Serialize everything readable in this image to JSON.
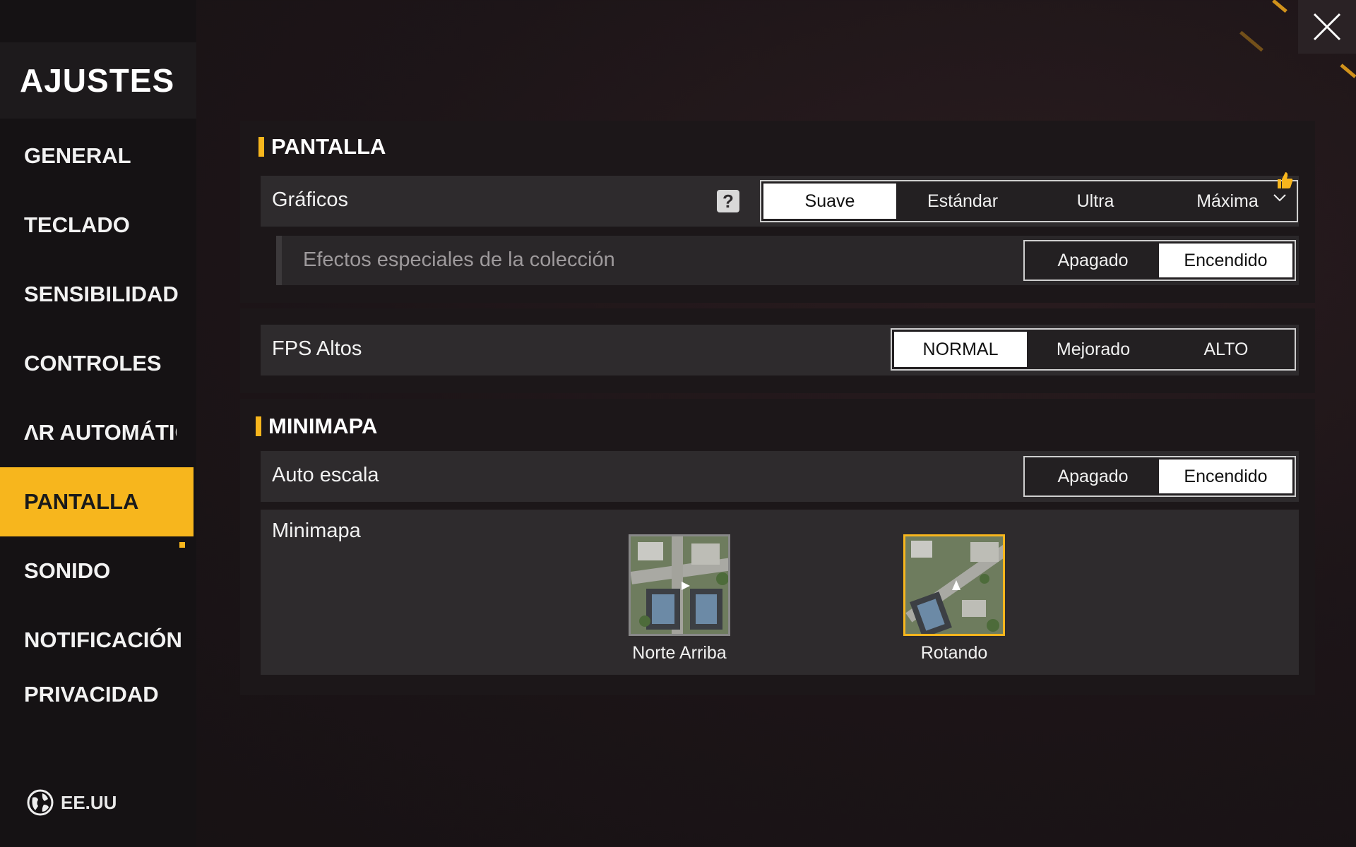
{
  "sidebar": {
    "title": "AJUSTES",
    "items": [
      {
        "label": "GENERAL"
      },
      {
        "label": "TECLADO"
      },
      {
        "label": "SENSIBILIDAD"
      },
      {
        "label": "CONTROLES"
      },
      {
        "label": "ΛR AUTOMÁTICAΜ"
      },
      {
        "label": "PANTALLA"
      },
      {
        "label": "SONIDO"
      },
      {
        "label": "NOTIFICACIÓN"
      },
      {
        "label": "PRIVACIDAD"
      }
    ],
    "active_index": 5,
    "region": "EE.UU"
  },
  "pantalla": {
    "title": "PANTALLA",
    "graficos": {
      "label": "Gráficos",
      "help": "?",
      "options": [
        "Suave",
        "Estándar",
        "Ultra",
        "Máxima"
      ],
      "selected": "Suave"
    },
    "efectos": {
      "label": "Efectos especiales de la colección",
      "options": [
        "Apagado",
        "Encendido"
      ],
      "selected": "Encendido"
    },
    "fps": {
      "label": "FPS Altos",
      "options": [
        "NORMAL",
        "Mejorado",
        "ALTO"
      ],
      "selected": "NORMAL"
    }
  },
  "minimapa": {
    "title": "MINIMAPA",
    "auto_escala": {
      "label": "Auto escala",
      "options": [
        "Apagado",
        "Encendido"
      ],
      "selected": "Encendido"
    },
    "minimapa_row": {
      "label": "Minimapa",
      "options": [
        {
          "label": "Norte Arriba",
          "selected": false
        },
        {
          "label": "Rotando",
          "selected": true
        }
      ]
    }
  },
  "colors": {
    "accent": "#f7b61d",
    "background": "#1d1518",
    "row": "#2e2b2d"
  },
  "icons": {
    "close": "close-icon",
    "globe": "globe-icon",
    "help": "help-icon",
    "chevron": "chevron-down-icon",
    "thumb": "thumbs-up-icon"
  }
}
